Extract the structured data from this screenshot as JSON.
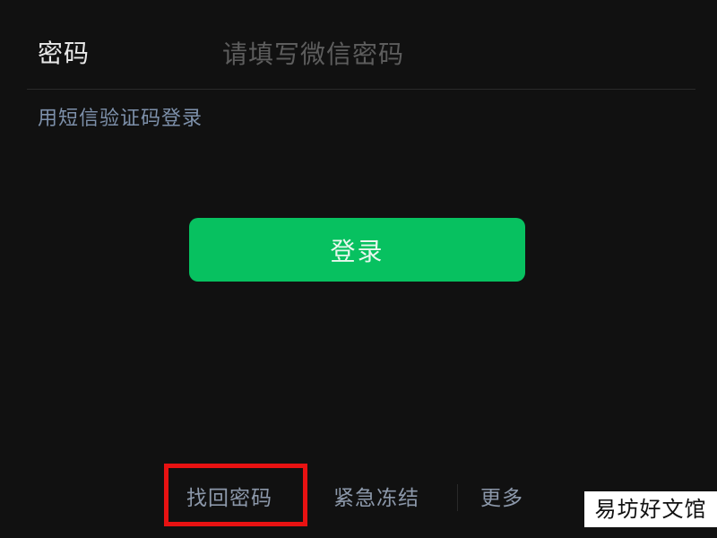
{
  "login_form": {
    "password_label": "密码",
    "password_placeholder": "请填写微信密码",
    "password_value": "",
    "sms_login_link": "用短信验证码登录",
    "login_button": "登录"
  },
  "footer": {
    "links": [
      {
        "label": "找回密码",
        "highlighted": true
      },
      {
        "label": "紧急冻结"
      },
      {
        "label": "更多"
      }
    ]
  },
  "annotation": {
    "highlight_color": "#e81212"
  },
  "watermark": {
    "text": "易坊好文馆"
  },
  "colors": {
    "background": "#111111",
    "primary_button": "#07c160",
    "link": "#7d90aa",
    "placeholder": "#5d5d5d"
  }
}
